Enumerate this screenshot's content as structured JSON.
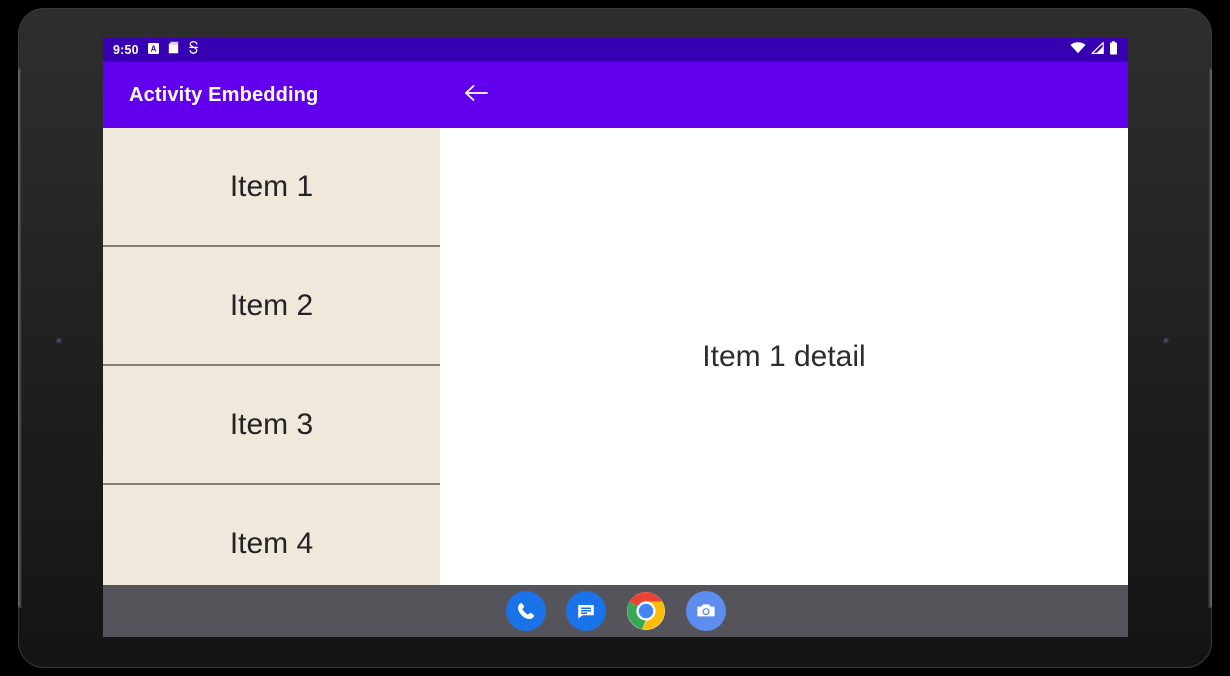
{
  "device": {
    "frame_color": "#272727",
    "sensor_icon": "camera-sensor-dot"
  },
  "status_bar": {
    "background": "#3700B3",
    "clock": "9:50",
    "left_icons": [
      {
        "name": "alarm-letter-badge-icon",
        "glyph": "A"
      },
      {
        "name": "bag-icon",
        "glyph": "bag"
      },
      {
        "name": "s-shape-icon",
        "glyph": "S"
      }
    ],
    "right_icons": [
      {
        "name": "wifi-icon",
        "glyph": "wifi"
      },
      {
        "name": "cellular-signal-icon",
        "glyph": "signal"
      },
      {
        "name": "battery-icon",
        "glyph": "battery"
      }
    ]
  },
  "app_bar": {
    "background": "#6200EE",
    "title": "Activity Embedding",
    "back_icon": "back-arrow-icon"
  },
  "content": {
    "list_pane": {
      "background": "#F0E8DA",
      "divider_color": "#85807A",
      "items": [
        {
          "label": "Item 1"
        },
        {
          "label": "Item 2"
        },
        {
          "label": "Item 3"
        },
        {
          "label": "Item 4"
        }
      ]
    },
    "detail_pane": {
      "background": "#FFFFFF",
      "text": "Item 1 detail"
    }
  },
  "taskbar": {
    "background": "#54545A",
    "icons": [
      {
        "name": "phone-icon",
        "label": "Phone",
        "color": "#1A73E8"
      },
      {
        "name": "messages-icon",
        "label": "Messages",
        "color": "#1A73E8"
      },
      {
        "name": "chrome-icon",
        "label": "Chrome",
        "color": "#4285F4"
      },
      {
        "name": "camera-icon",
        "label": "Camera",
        "color": "#5C8DEF"
      }
    ]
  }
}
